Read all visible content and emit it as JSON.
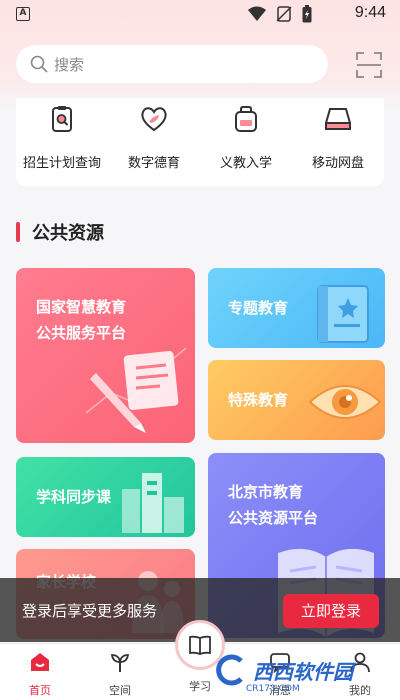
{
  "status_bar": {
    "app_icon_letter": "A",
    "time": "9:44"
  },
  "search": {
    "placeholder": "搜索"
  },
  "quick_links": [
    {
      "label": "招生计划查询",
      "icon": "clipboard-search-icon"
    },
    {
      "label": "数字德育",
      "icon": "heart-leaf-icon"
    },
    {
      "label": "义教入学",
      "icon": "backpack-icon"
    },
    {
      "label": "移动网盘",
      "icon": "hard-drive-icon"
    }
  ],
  "section": {
    "title": "公共资源"
  },
  "cards": {
    "national": {
      "line1": "国家智慧教育",
      "line2": "公共服务平台"
    },
    "special_topic": {
      "label": "专题教育"
    },
    "special_edu": {
      "label": "特殊教育"
    },
    "sync_course": {
      "label": "学科同步课"
    },
    "beijing": {
      "line1": "北京市教育",
      "line2": "公共资源平台"
    },
    "parent_school": {
      "label": "家长学校"
    }
  },
  "login_prompt": {
    "text": "登录后享受更多服务",
    "button": "立即登录"
  },
  "tabs": [
    {
      "label": "首页",
      "icon": "home-icon",
      "active": true
    },
    {
      "label": "空间",
      "icon": "sprout-icon",
      "active": false
    },
    {
      "label": "学习",
      "icon": "book-icon",
      "active": false
    },
    {
      "label": "消息",
      "icon": "message-icon",
      "active": false
    },
    {
      "label": "我的",
      "icon": "profile-icon",
      "active": false
    }
  ],
  "watermark": {
    "text": "西西软件园",
    "sub": "CR173.COM"
  },
  "colors": {
    "accent": "#e8293f",
    "section_bar": "#e8394a",
    "page_bg": "#f6f6f8"
  }
}
